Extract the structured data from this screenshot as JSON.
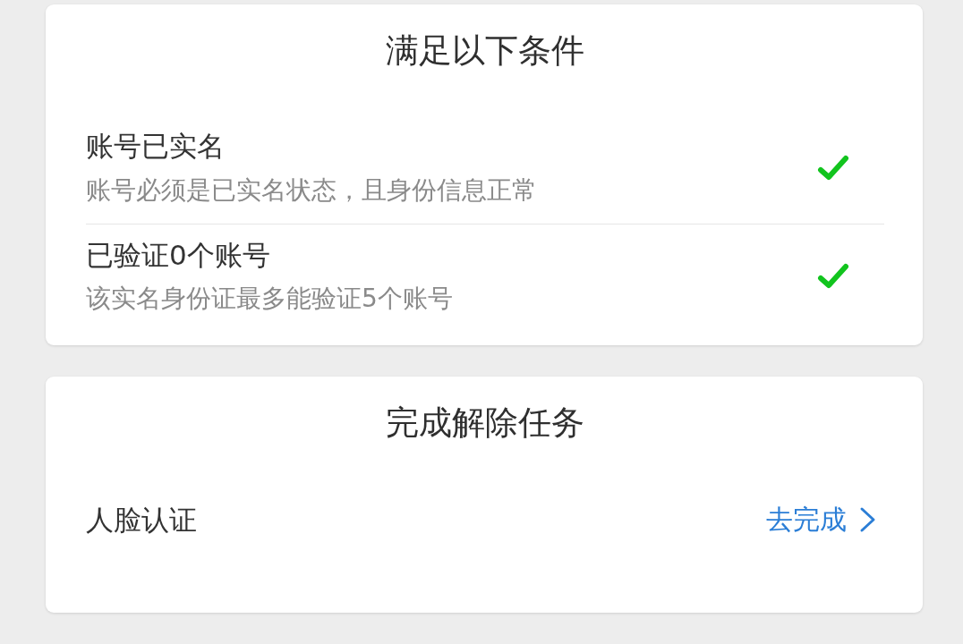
{
  "sections": [
    {
      "kind": "conditions",
      "title": "满足以下条件",
      "items": [
        {
          "title": "账号已实名",
          "description": "账号必须是已实名状态，且身份信息正常",
          "met": true
        },
        {
          "title": "已验证0个账号",
          "description": "该实名身份证最多能验证5个账号",
          "met": true
        }
      ]
    },
    {
      "kind": "tasks",
      "title": "完成解除任务",
      "items": [
        {
          "label": "人脸认证",
          "action": "去完成"
        }
      ]
    }
  ]
}
